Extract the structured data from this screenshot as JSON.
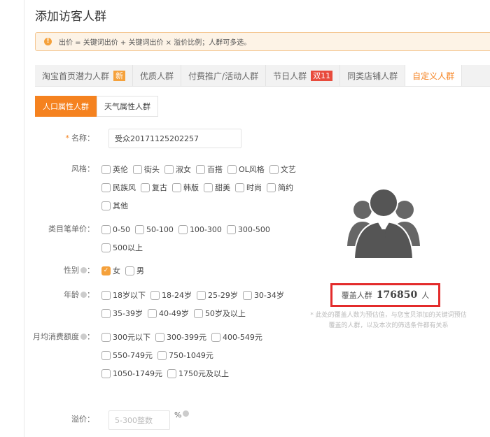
{
  "title": "添加访客人群",
  "alert": "出价 = 关键词出价 + 关键词出价 × 溢价比例；人群可多选。",
  "tabs": [
    {
      "label": "淘宝首页潜力人群",
      "badge": "新",
      "badge_color": "#f5a13b"
    },
    {
      "label": "优质人群"
    },
    {
      "label": "付费推广/活动人群"
    },
    {
      "label": "节日人群",
      "badge": "双11",
      "badge_color": "#e84b3c"
    },
    {
      "label": "同类店铺人群"
    },
    {
      "label": "自定义人群",
      "active": true
    }
  ],
  "subtabs": [
    "人口属性人群",
    "天气属性人群"
  ],
  "form": {
    "name_label": "名称：",
    "name_value": "受众20171125202257",
    "style_label": "风格：",
    "style": [
      "英伦",
      "街头",
      "淑女",
      "百搭",
      "OL风格",
      "文艺",
      "民族风",
      "复古",
      "韩版",
      "甜美",
      "时尚",
      "简约",
      "其他"
    ],
    "price_label": "类目笔单价：",
    "price": [
      "0-50",
      "50-100",
      "100-300",
      "300-500",
      "500以上"
    ],
    "gender_label": "性别",
    "gender": [
      {
        "label": "女",
        "checked": true
      },
      {
        "label": "男",
        "checked": false
      }
    ],
    "age_label": "年龄",
    "age": [
      "18岁以下",
      "18-24岁",
      "25-29岁",
      "30-34岁",
      "35-39岁",
      "40-49岁",
      "50岁及以上"
    ],
    "spend_label": "月均消费额度",
    "spend": [
      "300元以下",
      "300-399元",
      "400-549元",
      "550-749元",
      "750-1049元",
      "1050-1749元",
      "1750元及以上"
    ],
    "premium_label": "溢价：",
    "premium_placeholder": "5-300整数",
    "premium_unit": "%"
  },
  "coverage": {
    "label": "覆盖人群",
    "value": "176850",
    "unit": "人",
    "note": "* 此处的覆盖人数为预估值，与您宝贝添加的关键词预估覆盖的人群，以及本次的筛选条件都有关系"
  }
}
